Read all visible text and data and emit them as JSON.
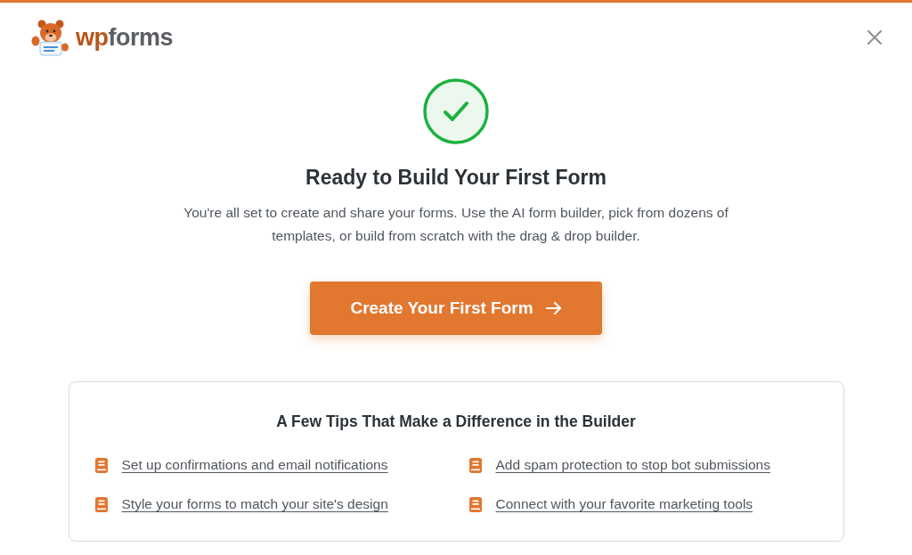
{
  "logo": {
    "accent": "wp",
    "rest": "forms"
  },
  "heading": "Ready to Build Your First Form",
  "description": "You're all set to create and share your forms. Use the AI form builder, pick from dozens of templates, or build from scratch with the drag & drop builder.",
  "primary_button": {
    "label": "Create Your First Form"
  },
  "tips": {
    "title": "A Few Tips That Make a Difference in the Builder",
    "items": [
      {
        "label": "Set up confirmations and email notifications"
      },
      {
        "label": "Add spam protection to stop bot submissions"
      },
      {
        "label": "Style your forms to match your site's design"
      },
      {
        "label": "Connect with your favorite marketing tools"
      }
    ]
  }
}
